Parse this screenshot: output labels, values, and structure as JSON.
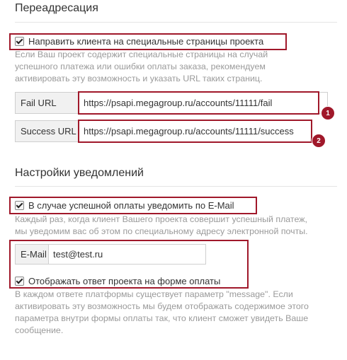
{
  "redirect": {
    "title": "Переадресация",
    "checkbox_label": "Направить клиента на специальные страницы проекта",
    "checkbox_checked": true,
    "help_lines": [
      "Если Ваш проект содержит специальные страницы на случай",
      "успешного платежа или ошибки оплаты заказа, рекомендуем",
      "активировать эту возможность и указать URL таких страниц."
    ],
    "fail_url": {
      "label": "Fail URL",
      "value": "https://psapi.megagroup.ru/accounts/11111/fail",
      "badge": "1"
    },
    "success_url": {
      "label": "Success URL",
      "value": "https://psapi.megagroup.ru/accounts/11111/success",
      "badge": "2"
    }
  },
  "notifications": {
    "title": "Настройки уведомлений",
    "checkbox_label": "В случае успешной оплаты уведомить по E-Mail",
    "checkbox_checked": true,
    "help_lines": [
      "Каждый раз, когда клиент Вашего проекта совершит успешный платеж,",
      "мы уведомим вас об этом по специальному адресу электронной почты."
    ],
    "email": {
      "label": "E-Mail",
      "value": "test@test.ru"
    },
    "show_response_label": "Отображать ответ проекта на форме оплаты",
    "show_response_checked": true,
    "response_help_lines": [
      "В каждом ответе платформы существует параметр \"message\". Если",
      "активировать эту возможность мы будем отображать содержимое этого",
      "параметра внутри формы оплаты так, что клиент сможет увидеть Ваше",
      "сообщение."
    ]
  },
  "colors": {
    "accent_red": "#a0182a",
    "help_text": "#9a9a9a"
  }
}
